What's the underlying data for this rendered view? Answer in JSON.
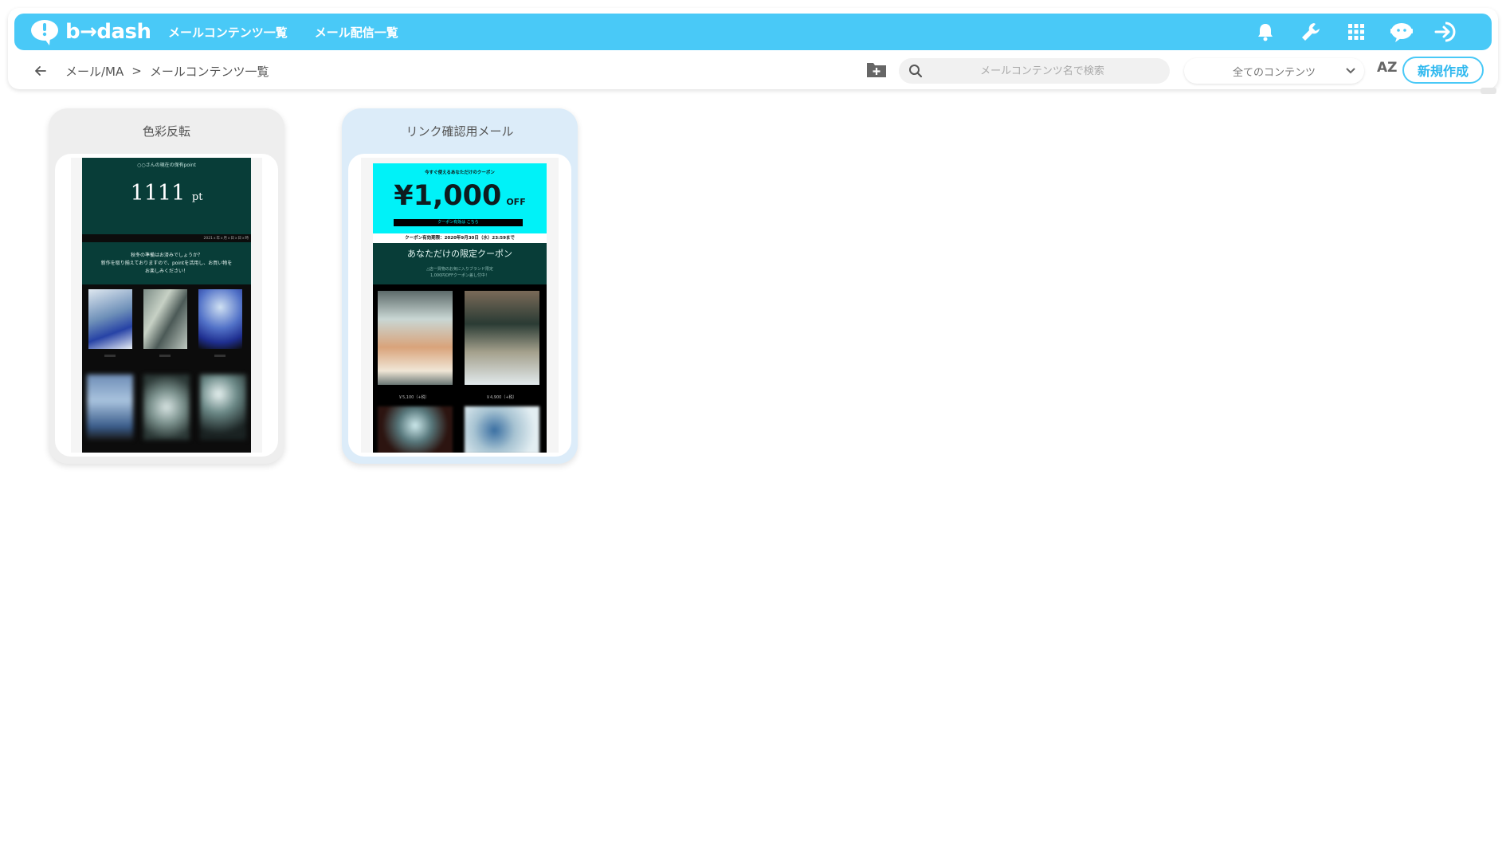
{
  "header": {
    "logo_text": "b→dash",
    "nav": [
      "メールコンテンツ一覧",
      "メール配信一覧"
    ],
    "icons": [
      "bell-icon",
      "wrench-icon",
      "apps-grid-icon",
      "chatbot-icon",
      "logout-icon"
    ]
  },
  "toolbar": {
    "breadcrumb": [
      "メール/MA",
      "メールコンテンツ一覧"
    ],
    "breadcrumb_separator": ">",
    "search_placeholder": "メールコンテンツ名で検索",
    "filter_selected": "全てのコンテンツ",
    "sort_label": "AZ",
    "new_button": "新規作成"
  },
  "colors": {
    "brand": "#49c9f7",
    "card1_bg": "#eeeeee",
    "card2_bg": "#dcecf9",
    "thumb_dark_teal": "#083d38",
    "thumb_cyan": "#00f2f8"
  },
  "cards": [
    {
      "title": "色彩反転",
      "thumb": {
        "heading": "○○さんの現在の保有point",
        "points": "1111",
        "unit": "pt",
        "date": "2021ｘ年ｘ月ｘ日ｘ日ｘ時",
        "message_line1": "秋冬の準備はお済みでしょうか？",
        "message_line2": "新作を取り揃えておりますので、pointを活用し、お買い物を",
        "message_line3": "お楽しみください！"
      }
    },
    {
      "title": "リンク確認用メール",
      "thumb": {
        "subheading": "今すぐ使えるあなただけのクーポン",
        "price": "¥1,000",
        "off": "OFF",
        "code_bar": "クーポン有効は こちら",
        "expiry": "クーポン有効期限：2020年9月30日（水）23:59まで",
        "limited_title": "あなただけの限定クーポン",
        "limited_desc1": "△店一買物のお気に入りブランド限定",
        "limited_desc2": "1,000円OFFクーポン差し付中！",
        "price1": "￥5,100（+税）",
        "price2": "￥4,900（+税）"
      }
    }
  ]
}
